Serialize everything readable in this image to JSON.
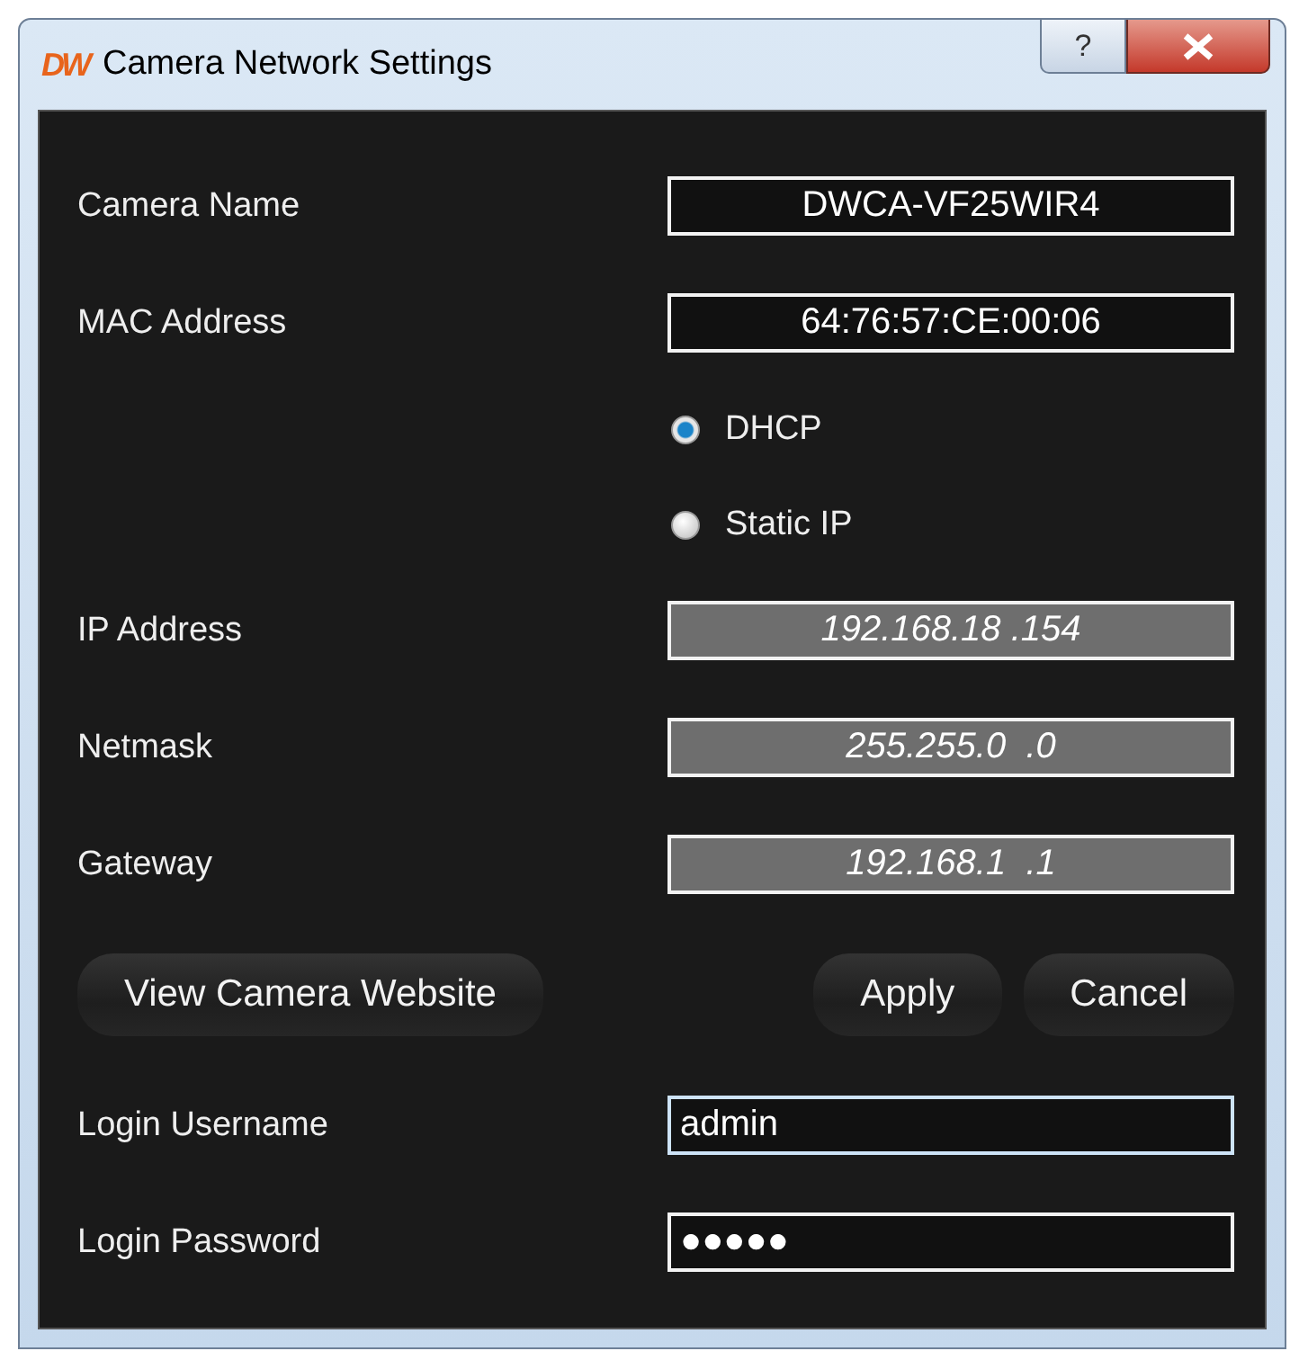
{
  "window": {
    "logo": "DW",
    "title": "Camera Network Settings",
    "help": "?"
  },
  "fields_top": [
    {
      "label": "Camera Name",
      "value": "DWCA-VF25WIR4",
      "disabled": false,
      "focused": false
    },
    {
      "label": "MAC Address",
      "value": "64:76:57:CE:00:06",
      "disabled": false,
      "focused": false
    }
  ],
  "radios": [
    {
      "label": "DHCP",
      "selected": true
    },
    {
      "label": "Static IP",
      "selected": false
    }
  ],
  "fields_ip": [
    {
      "label": "IP Address",
      "value": "192.168.18 .154",
      "disabled": true,
      "focused": false
    },
    {
      "label": "Netmask",
      "value": "255.255.0  .0",
      "disabled": true,
      "focused": false
    },
    {
      "label": "Gateway",
      "value": "192.168.1  .1",
      "disabled": true,
      "focused": false
    }
  ],
  "buttons": {
    "website": "View Camera Website",
    "apply": "Apply",
    "cancel": "Cancel"
  },
  "fields_login": [
    {
      "label": "Login Username",
      "value": "admin",
      "disabled": false,
      "focused": true
    },
    {
      "label": "Login Password",
      "value": "●●●●●",
      "disabled": false,
      "focused": false
    }
  ]
}
